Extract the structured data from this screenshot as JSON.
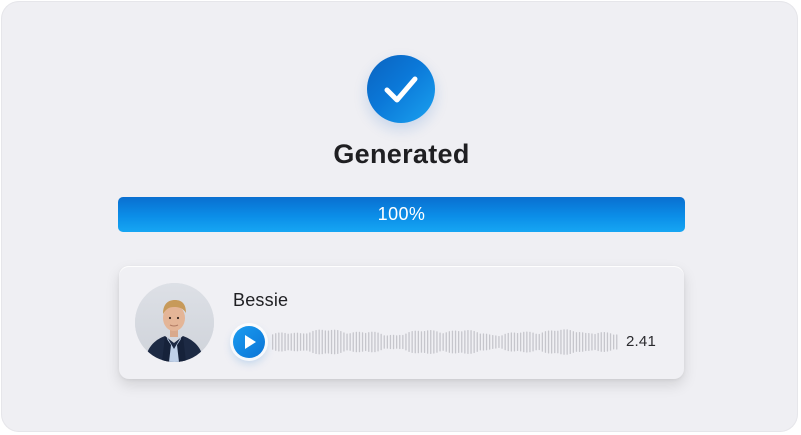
{
  "status": {
    "title": "Generated",
    "icon": "checkmark-icon"
  },
  "progress": {
    "label": "100%",
    "value": 1.0
  },
  "voice": {
    "name": "Bessie",
    "duration": "2.41",
    "play_icon": "play-icon"
  },
  "colors": {
    "accent": "#0b78d8",
    "accent_light": "#1aa2f0",
    "background": "#efeff3",
    "waveform": "#c6c6cc",
    "text": "#1f1f22"
  }
}
